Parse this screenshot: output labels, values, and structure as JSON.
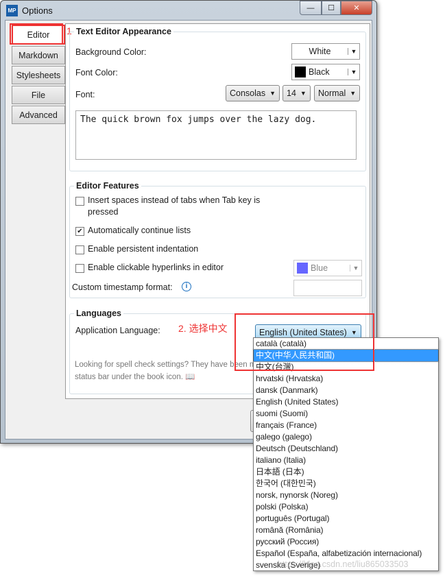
{
  "window": {
    "title": "Options",
    "logo": "MP",
    "minimize": "—",
    "maximize": "☐",
    "close": "✕"
  },
  "tabs": [
    {
      "label": "Editor",
      "selected": true
    },
    {
      "label": "Markdown"
    },
    {
      "label": "Stylesheets"
    },
    {
      "label": "File"
    },
    {
      "label": "Advanced"
    }
  ],
  "annotations": {
    "step1": "1",
    "step2": "2. 选择中文"
  },
  "appearance": {
    "header": "Text Editor Appearance",
    "bg_label": "Background Color:",
    "bg_value": "White",
    "fg_label": "Font Color:",
    "fg_value": "Black",
    "fg_swatch": "#000000",
    "font_label": "Font:",
    "font_family": "Consolas",
    "font_size": "14",
    "font_weight": "Normal",
    "preview": "The quick brown fox jumps over the lazy dog."
  },
  "features": {
    "header": "Editor Features",
    "items": [
      {
        "label": "Insert spaces instead of tabs when Tab key is pressed",
        "checked": false
      },
      {
        "label": "Automatically continue lists",
        "checked": true
      },
      {
        "label": "Enable persistent indentation",
        "checked": false
      },
      {
        "label": "Enable clickable hyperlinks in editor",
        "checked": false
      }
    ],
    "link_color": "Blue",
    "link_swatch": "#6666ff",
    "timestamp_label": "Custom timestamp format:",
    "timestamp_value": "",
    "info_icon": "i"
  },
  "languages": {
    "header": "Languages",
    "app_lang_label": "Application Language:",
    "selected": "English (United States)",
    "spell_note": "Looking for spell check settings? They have been m",
    "spell_note2": "status bar under the book icon. 📖",
    "options": [
      "català (català)",
      "中文(中华人民共和国)",
      "中文(台灣)",
      "hrvatski (Hrvatska)",
      "dansk (Danmark)",
      "English (United States)",
      "suomi (Suomi)",
      "français (France)",
      "galego (galego)",
      "Deutsch (Deutschland)",
      "italiano (Italia)",
      "日本語 (日本)",
      "한국어 (대한민국)",
      "norsk, nynorsk (Noreg)",
      "polski (Polska)",
      "português (Portugal)",
      "română (România)",
      "русский (Россия)",
      "Español (España, alfabetización internacional)",
      "svenska (Sverige)"
    ],
    "highlighted_index": 1
  },
  "watermark": "https://blog.csdn.net/liu865033503"
}
